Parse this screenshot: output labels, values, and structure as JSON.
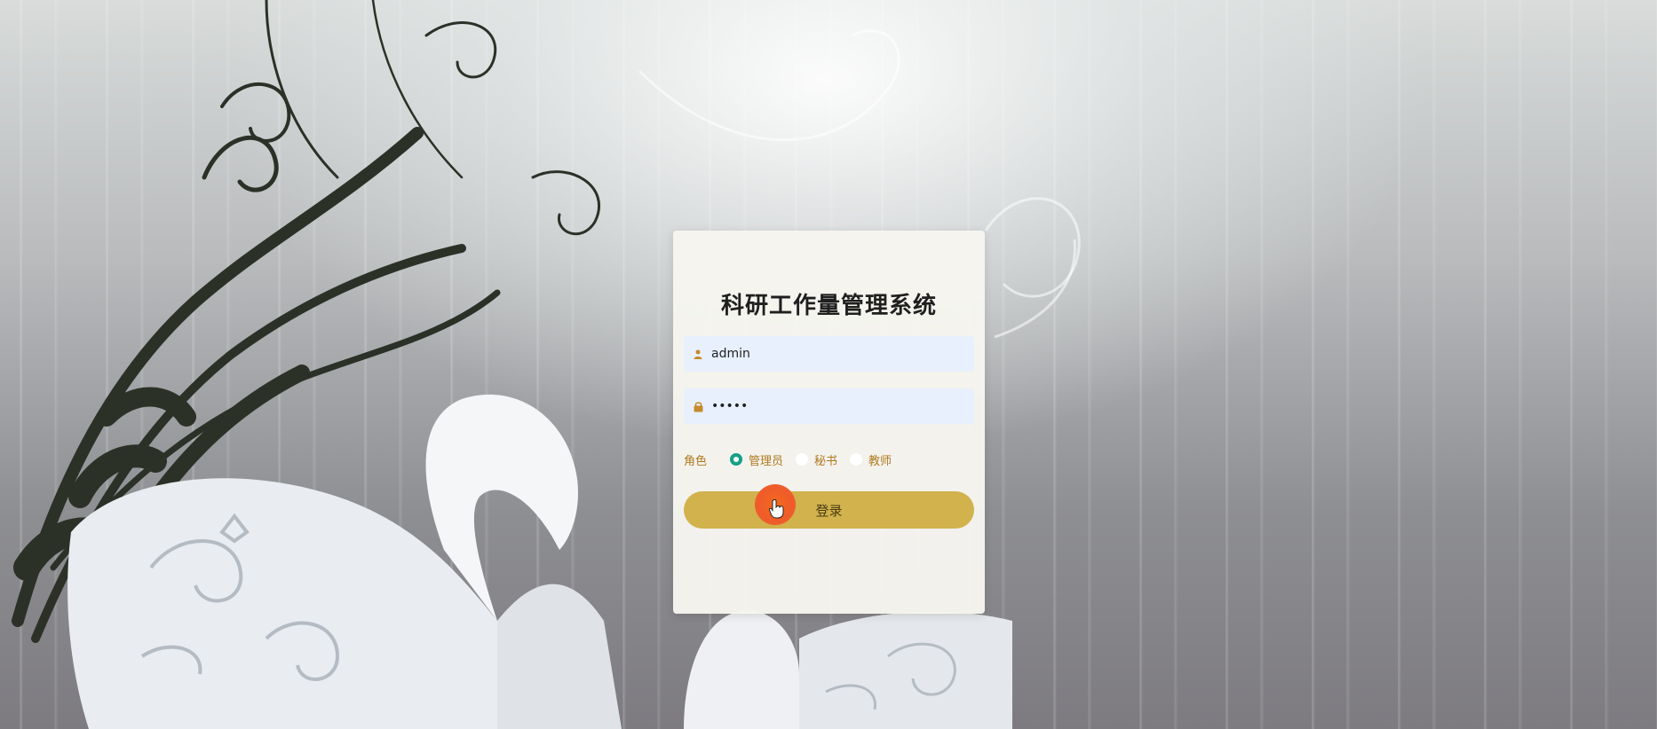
{
  "login": {
    "title": "科研工作量管理系统",
    "username": {
      "value": "admin",
      "icon": "user-icon"
    },
    "password": {
      "value": "•••••",
      "icon": "lock-icon"
    },
    "role": {
      "label": "角色",
      "options": [
        "管理员",
        "秘书",
        "教师"
      ],
      "selected": "管理员"
    },
    "submit_label": "登录"
  },
  "colors": {
    "accent": "#d1b24c",
    "role_text": "#b07a1e",
    "radio_checked": "#16a085",
    "input_bg": "#e8f0fe",
    "cursor_highlight": "#ef5b2a"
  }
}
